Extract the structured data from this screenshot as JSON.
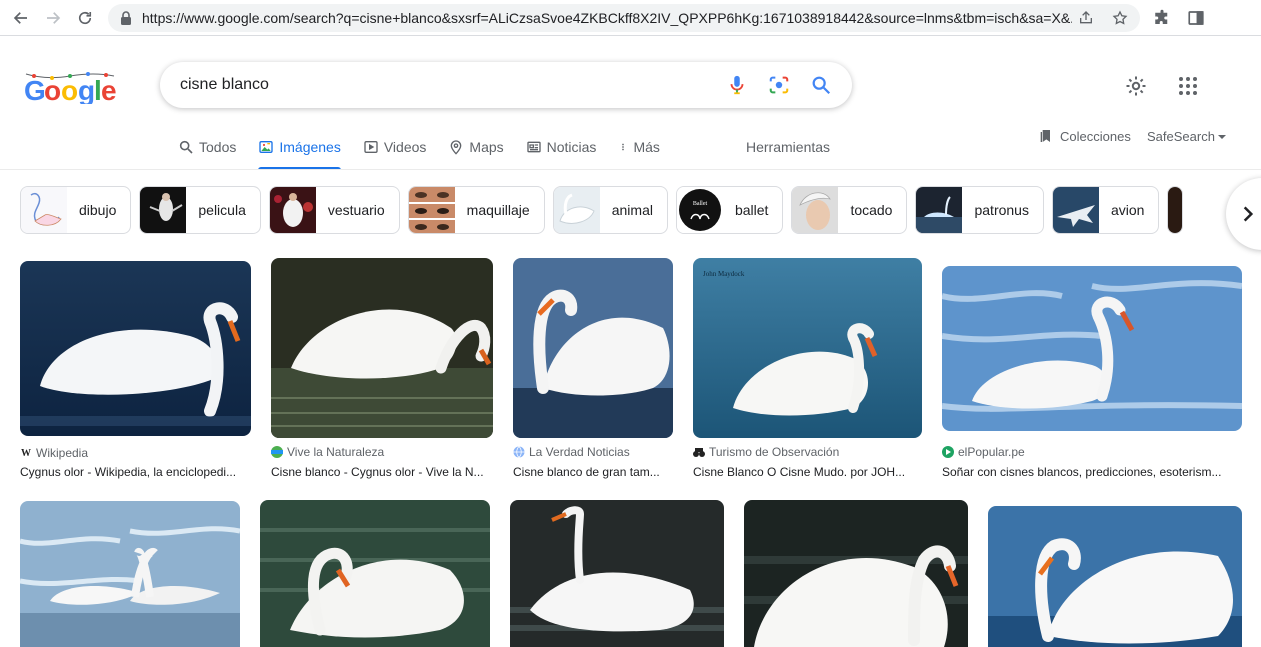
{
  "browser": {
    "url": "https://www.google.com/search?q=cisne+blanco&sxsrf=ALiCzsaSvoe4ZKBCkff8X2IV_QPXPP6hKg:1671038918442&source=lnms&tbm=isch&sa=X&..."
  },
  "search": {
    "query": "cisne blanco"
  },
  "tabs": [
    {
      "label": "Todos"
    },
    {
      "label": "Imágenes"
    },
    {
      "label": "Videos"
    },
    {
      "label": "Maps"
    },
    {
      "label": "Noticias"
    },
    {
      "label": "Más"
    }
  ],
  "tools_label": "Herramientas",
  "collections_label": "Colecciones",
  "safesearch_label": "SafeSearch",
  "chips": [
    {
      "label": "dibujo"
    },
    {
      "label": "pelicula"
    },
    {
      "label": "vestuario"
    },
    {
      "label": "maquillaje"
    },
    {
      "label": "animal"
    },
    {
      "label": "ballet"
    },
    {
      "label": "tocado"
    },
    {
      "label": "patronus"
    },
    {
      "label": "avion"
    }
  ],
  "results": [
    {
      "source": "Wikipedia",
      "title": "Cygnus olor - Wikipedia, la enciclopedi..."
    },
    {
      "source": "Vive la Naturaleza",
      "title": "Cisne blanco - Cygnus olor - Vive la N..."
    },
    {
      "source": "La Verdad Noticias",
      "title": "Cisne blanco de gran tam..."
    },
    {
      "source": "Turismo de Observación",
      "title": "Cisne Blanco O Cisne Mudo. por JOH..."
    },
    {
      "source": "elPopular.pe",
      "title": "Soñar con cisnes blancos, predicciones, esoterism..."
    }
  ],
  "colors": {
    "accent": "#1a73e8",
    "text_secondary": "#5f6368",
    "border": "#dadce0"
  }
}
